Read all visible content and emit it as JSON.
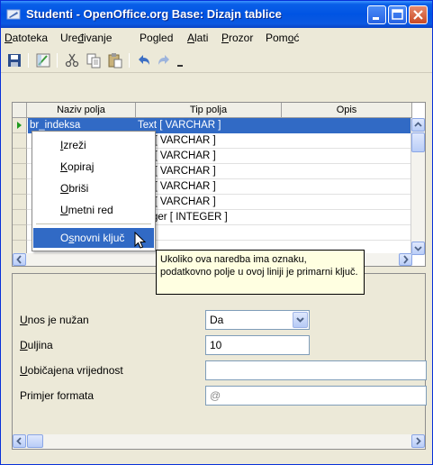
{
  "window": {
    "title": "Studenti - OpenOffice.org Base: Dizajn tablice"
  },
  "menu": {
    "items": [
      {
        "pre": "",
        "key": "D",
        "post": "atoteka"
      },
      {
        "pre": "Ure",
        "key": "đ",
        "post": "ivanje"
      },
      {
        "pre": "Po",
        "key": "g",
        "post": "led"
      },
      {
        "pre": "",
        "key": "A",
        "post": "lati"
      },
      {
        "pre": "",
        "key": "P",
        "post": "rozor"
      },
      {
        "pre": "Pom",
        "key": "o",
        "post": "ć"
      }
    ]
  },
  "grid": {
    "headers": [
      "Naziv polja",
      "Tip polja",
      "Opis"
    ],
    "rows": [
      {
        "name": "br_indeksa",
        "type": "Text [ VARCHAR ]",
        "selected": true
      },
      {
        "name": "",
        "type": "ext [ VARCHAR ]"
      },
      {
        "name": "",
        "type": "ext [ VARCHAR ]"
      },
      {
        "name": "",
        "type": "ext [ VARCHAR ]"
      },
      {
        "name": "",
        "type": "ext [ VARCHAR ]"
      },
      {
        "name": "",
        "type": "ext [ VARCHAR ]"
      },
      {
        "name": "",
        "type": "nteger [ INTEGER ]"
      }
    ]
  },
  "context_menu": {
    "items": [
      {
        "pre": "",
        "key": "I",
        "post": "zreži"
      },
      {
        "pre": "",
        "key": "K",
        "post": "opiraj"
      },
      {
        "pre": "",
        "key": "O",
        "post": "briši"
      },
      {
        "pre": "",
        "key": "U",
        "post": "metni red"
      },
      {
        "pre": "O",
        "key": "s",
        "post": "novni ključ",
        "selected": true
      }
    ]
  },
  "tooltip": {
    "text": "Ukoliko ova naredba ima oznaku, podatkovno polje u ovoj liniji je primarni ključ."
  },
  "properties": {
    "required": {
      "pre": "",
      "key": "U",
      "post": "nos je nužan",
      "value": "Da"
    },
    "length": {
      "pre": "",
      "key": "D",
      "post": "uljina",
      "value": "10"
    },
    "default": {
      "pre": "",
      "key": "U",
      "post": "običajena vrijednost",
      "value": ""
    },
    "format": {
      "pre": "Primjer formata",
      "key": "",
      "post": "",
      "value": "@"
    }
  },
  "colors": {
    "titlebar": "#0054e3",
    "selection": "#316ac5",
    "tooltip_bg": "#ffffe1",
    "panel": "#ece9d8"
  }
}
